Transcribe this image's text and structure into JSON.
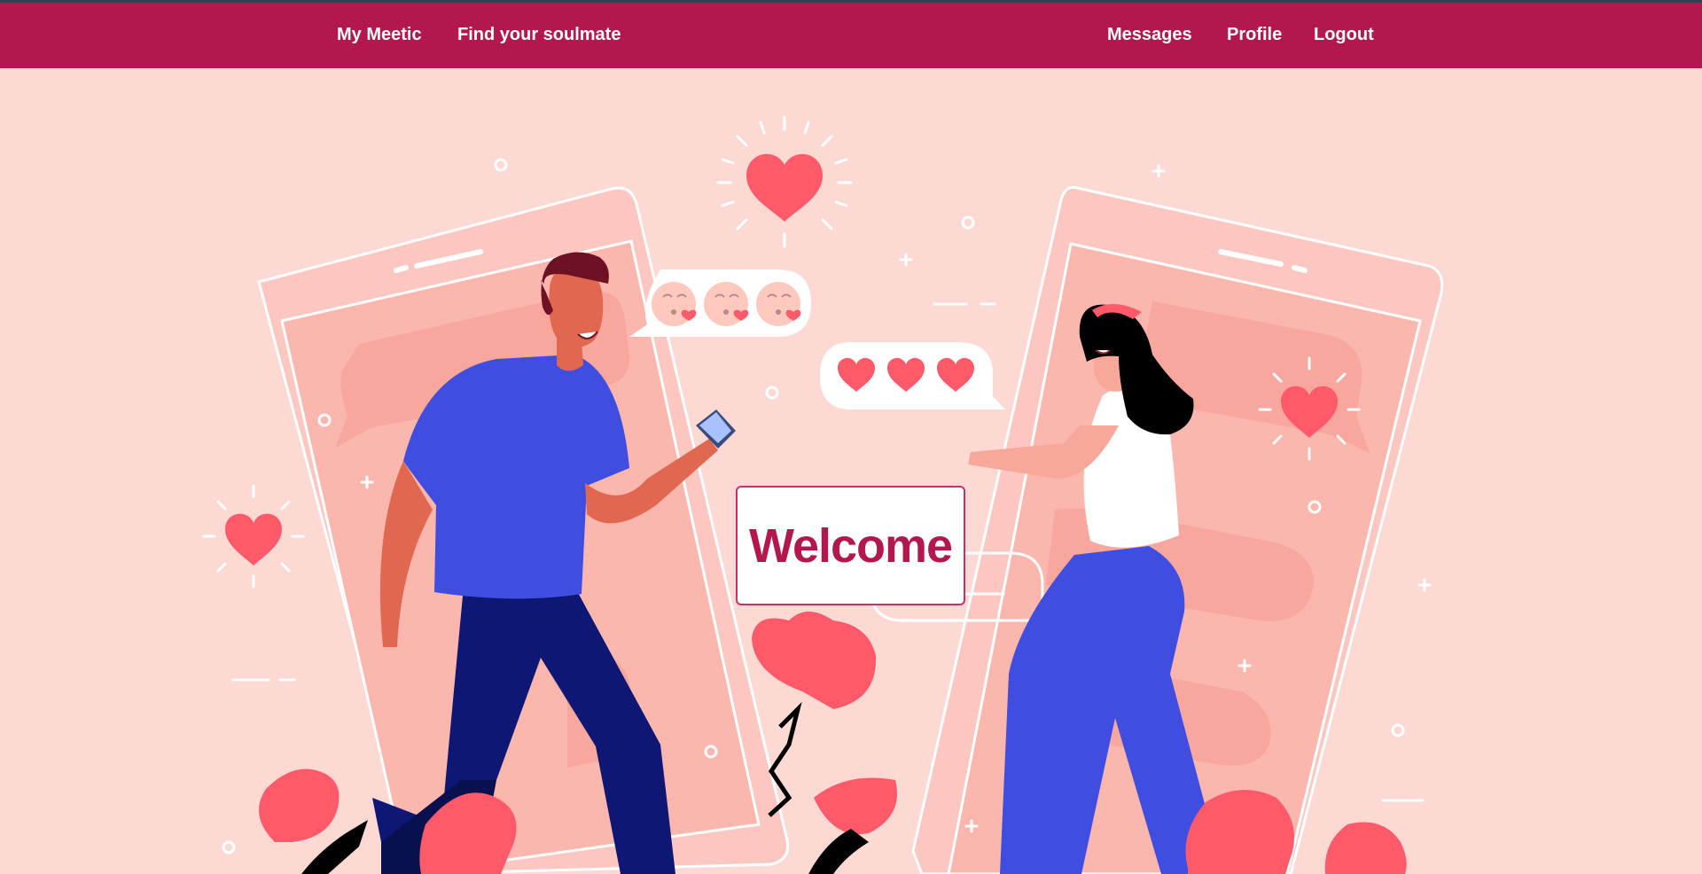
{
  "nav": {
    "left": [
      {
        "label": "My Meetic"
      },
      {
        "label": "Find your soulmate"
      }
    ],
    "right": [
      {
        "label": "Messages"
      },
      {
        "label": "Profile"
      },
      {
        "label": "Logout"
      }
    ]
  },
  "hero": {
    "welcome": "Welcome",
    "illustration": "two-people-dating-app-phones",
    "icons": [
      "heart-icon",
      "kiss-emoji-icon",
      "speech-bubble-icon",
      "flower-icon"
    ]
  },
  "colors": {
    "navbar": "#b2184d",
    "background": "#fdd9d4",
    "heart": "#ff5a6a",
    "welcome_text": "#b2184d"
  }
}
